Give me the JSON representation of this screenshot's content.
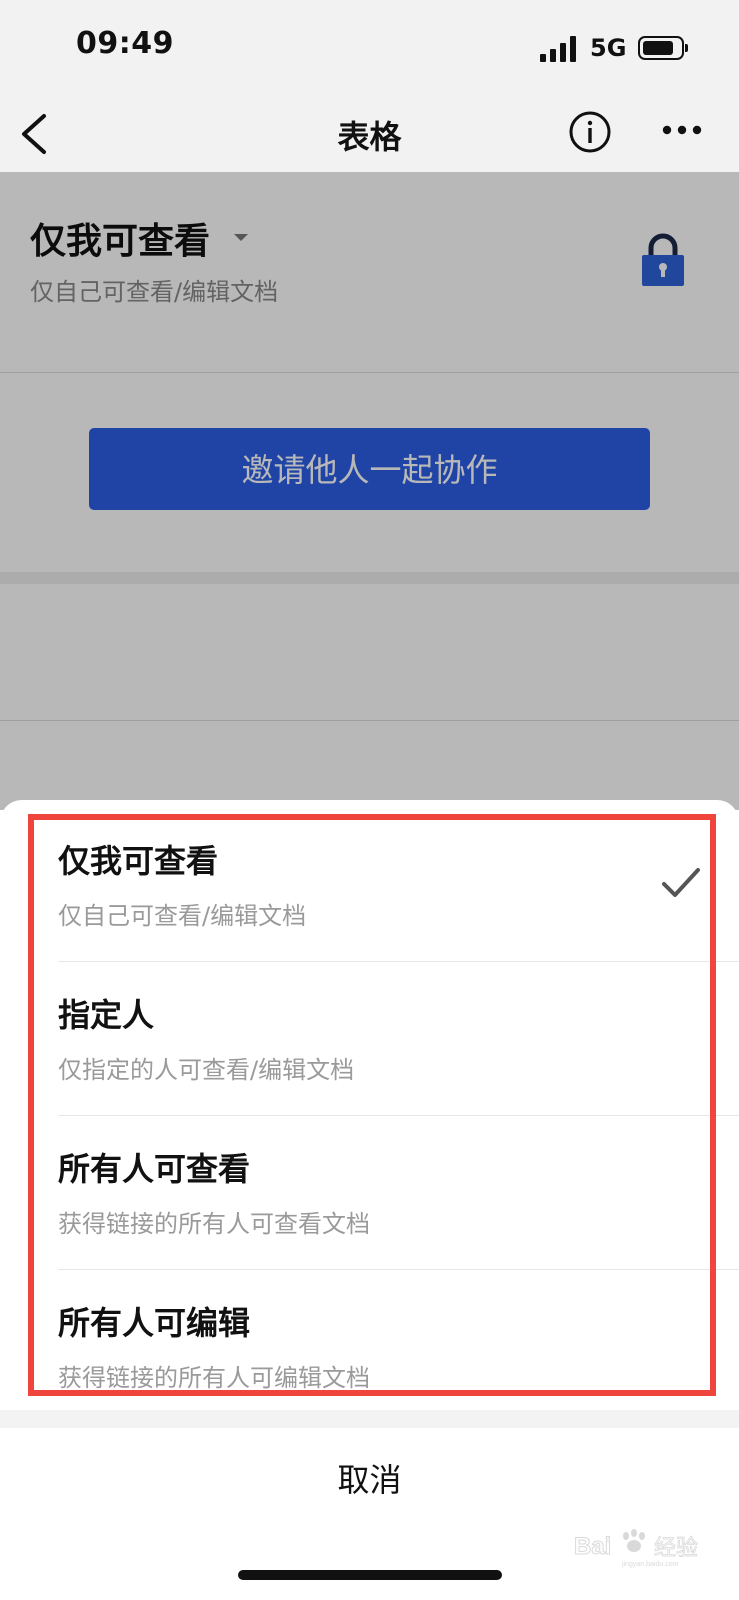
{
  "status_bar": {
    "time": "09:49",
    "network": "5G",
    "signal_icon": "signal-bars-icon",
    "battery_icon": "battery-icon"
  },
  "nav": {
    "title": "表格",
    "back_icon": "back-chevron-icon",
    "info_icon": "info-circle-icon",
    "more_icon": "more-dots-icon"
  },
  "page": {
    "permission_title": "仅我可查看",
    "permission_subtitle": "仅自己可查看/编辑文档",
    "lock_icon": "lock-icon",
    "invite_button": "邀请他人一起协作"
  },
  "sheet": {
    "options": [
      {
        "title": "仅我可查看",
        "subtitle": "仅自己可查看/编辑文档",
        "selected": true
      },
      {
        "title": "指定人",
        "subtitle": "仅指定的人可查看/编辑文档",
        "selected": false
      },
      {
        "title": "所有人可查看",
        "subtitle": "获得链接的所有人可查看文档",
        "selected": false
      },
      {
        "title": "所有人可编辑",
        "subtitle": "获得链接的所有人可编辑文档",
        "selected": false
      }
    ],
    "cancel": "取消"
  },
  "watermark": {
    "text": "Bai du 经验",
    "subtext": "jingyan.baidu.com"
  },
  "colors": {
    "accent": "#2b5fe6",
    "highlight_border": "#f0453c",
    "lock": "#2f63d8"
  }
}
